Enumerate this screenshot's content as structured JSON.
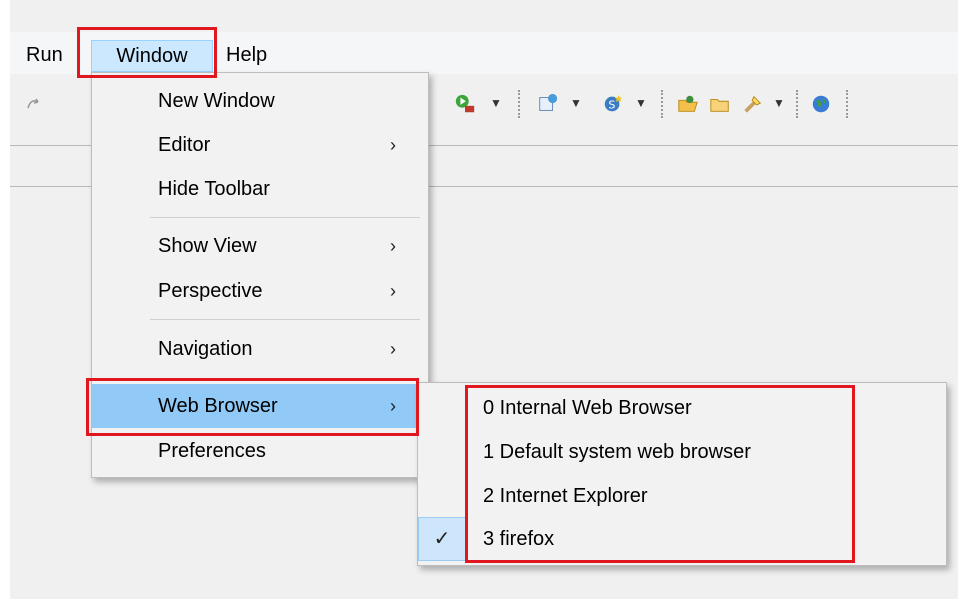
{
  "menubar": {
    "items": [
      {
        "label": "Run"
      },
      {
        "label": "Window"
      },
      {
        "label": "Help"
      }
    ]
  },
  "toolbar": {
    "icons": [
      "step-icon",
      "run-icon",
      "new-class-icon",
      "new-package-icon",
      "open-type-icon",
      "open-folder-icon",
      "search-icon",
      "globe-icon"
    ]
  },
  "window_menu": {
    "items": [
      {
        "label": "New Window",
        "submenu": false
      },
      {
        "label": "Editor",
        "submenu": true,
        "arrow": "›"
      },
      {
        "label": "Hide Toolbar",
        "submenu": false
      },
      {
        "label": "Show View",
        "submenu": true,
        "arrow": "›"
      },
      {
        "label": "Perspective",
        "submenu": true,
        "arrow": "›"
      },
      {
        "label": "Navigation",
        "submenu": true,
        "arrow": "›"
      },
      {
        "label": "Web Browser",
        "submenu": true,
        "arrow": "›",
        "highlighted": true
      },
      {
        "label": "Preferences",
        "submenu": false
      }
    ]
  },
  "web_browser_submenu": {
    "items": [
      {
        "label": "0 Internal Web Browser",
        "checked": false
      },
      {
        "label": "1 Default system web browser",
        "checked": false
      },
      {
        "label": "2 Internet Explorer",
        "checked": false
      },
      {
        "label": "3 firefox",
        "checked": true
      }
    ],
    "check_glyph": "✓"
  },
  "colors": {
    "highlight": "#91c9f7",
    "menubar_selected": "#cce8ff",
    "annotation_red": "#e0171f"
  }
}
